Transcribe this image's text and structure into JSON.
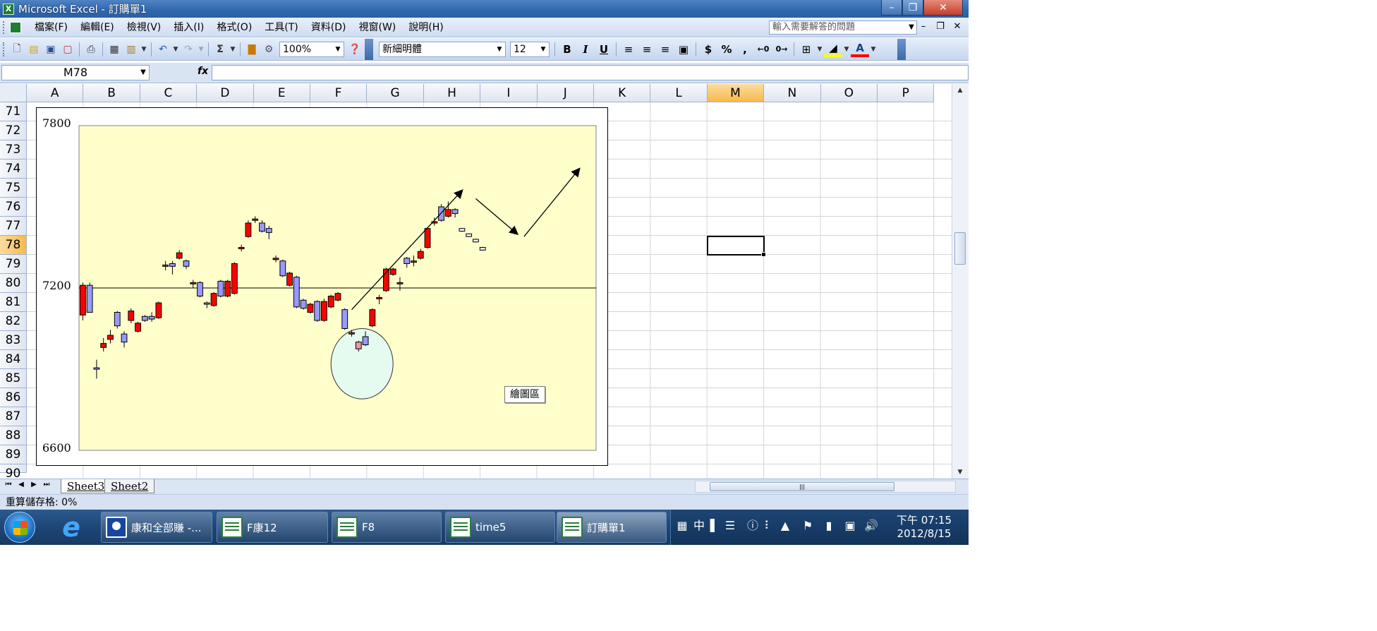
{
  "window": {
    "title": "Microsoft Excel - 訂購單1",
    "app_icon": "excel-icon"
  },
  "menu": {
    "items": [
      "檔案(F)",
      "編輯(E)",
      "檢視(V)",
      "插入(I)",
      "格式(O)",
      "工具(T)",
      "資料(D)",
      "視窗(W)",
      "說明(H)"
    ],
    "ask_placeholder": "輸入需要解答的問題"
  },
  "toolbar": {
    "zoom": "100%",
    "font_name": "新細明體",
    "font_size": "12",
    "bold": "B",
    "italic": "I",
    "underline": "U",
    "currency": "$",
    "percent": "%",
    "comma": ",",
    "sum": "Σ"
  },
  "formula": {
    "name_box": "M78",
    "fx_label": "fx",
    "value": ""
  },
  "grid": {
    "columns": [
      "A",
      "B",
      "C",
      "D",
      "E",
      "F",
      "G",
      "H",
      "I",
      "J",
      "K",
      "L",
      "M",
      "N",
      "O",
      "P"
    ],
    "rows": [
      "71",
      "72",
      "73",
      "74",
      "75",
      "76",
      "77",
      "78",
      "79",
      "80",
      "81",
      "82",
      "83",
      "84",
      "85",
      "86",
      "87",
      "88",
      "89",
      "90"
    ],
    "selected_column": "M",
    "selected_row": "78"
  },
  "sheets": {
    "tabs": [
      "Sheet3",
      "Sheet2"
    ]
  },
  "status": {
    "text": "重算儲存格: 0%"
  },
  "taskbar": {
    "items": [
      "康和全部賺 -...",
      "F康12",
      "F8",
      "time5",
      "訂購單1"
    ],
    "clock_time": "下午 07:15",
    "clock_date": "2012/8/15",
    "ime_label": "中"
  },
  "chart_data": {
    "type": "candlestick",
    "y_tick_labels": [
      "7800",
      "7200",
      "6600"
    ],
    "ylim": [
      6600,
      7800
    ],
    "reference_line": 7200,
    "plot_area_color": "#ffffcc",
    "up_color": "#ff0000",
    "down_color": "#9999ff",
    "plot_tooltip": "繪圖區",
    "candles": [
      {
        "o": 7100,
        "c": 7210,
        "h": 7220,
        "l": 7080,
        "up": true
      },
      {
        "o": 7210,
        "c": 7110,
        "h": 7220,
        "l": 7110,
        "up": false
      },
      {
        "o": 6900,
        "c": 6905,
        "h": 6935,
        "l": 6865,
        "up": false
      },
      {
        "o": 6980,
        "c": 6995,
        "h": 7015,
        "l": 6965,
        "up": true
      },
      {
        "o": 7010,
        "c": 7025,
        "h": 7045,
        "l": 6995,
        "up": true
      },
      {
        "o": 7110,
        "c": 7060,
        "h": 7115,
        "l": 7050,
        "up": false
      },
      {
        "o": 7030,
        "c": 7000,
        "h": 7040,
        "l": 6980,
        "up": false
      },
      {
        "o": 7080,
        "c": 7115,
        "h": 7125,
        "l": 7070,
        "up": true
      },
      {
        "o": 7040,
        "c": 7070,
        "h": 7075,
        "l": 7035,
        "up": true
      },
      {
        "o": 7095,
        "c": 7080,
        "h": 7100,
        "l": 7075,
        "up": false
      },
      {
        "o": 7095,
        "c": 7085,
        "h": 7110,
        "l": 7075,
        "up": false
      },
      {
        "o": 7090,
        "c": 7145,
        "h": 7150,
        "l": 7085,
        "up": true
      },
      {
        "o": 7280,
        "c": 7285,
        "h": 7300,
        "l": 7265,
        "up": true
      },
      {
        "o": 7280,
        "c": 7290,
        "h": 7300,
        "l": 7250,
        "up": false
      },
      {
        "o": 7330,
        "c": 7310,
        "h": 7340,
        "l": 7305,
        "up": true
      },
      {
        "o": 7300,
        "c": 7280,
        "h": 7305,
        "l": 7270,
        "up": false
      },
      {
        "o": 7215,
        "c": 7220,
        "h": 7230,
        "l": 7200,
        "up": true
      },
      {
        "o": 7220,
        "c": 7170,
        "h": 7225,
        "l": 7165,
        "up": false
      },
      {
        "o": 7145,
        "c": 7140,
        "h": 7150,
        "l": 7125,
        "up": false
      },
      {
        "o": 7135,
        "c": 7180,
        "h": 7185,
        "l": 7130,
        "up": true
      },
      {
        "o": 7225,
        "c": 7170,
        "h": 7230,
        "l": 7165,
        "up": false
      },
      {
        "o": 7170,
        "c": 7225,
        "h": 7230,
        "l": 7165,
        "up": true
      },
      {
        "o": 7180,
        "c": 7290,
        "h": 7295,
        "l": 7175,
        "up": true
      },
      {
        "o": 7345,
        "c": 7350,
        "h": 7360,
        "l": 7335,
        "up": true
      },
      {
        "o": 7390,
        "c": 7440,
        "h": 7450,
        "l": 7385,
        "up": true
      },
      {
        "o": 7450,
        "c": 7455,
        "h": 7465,
        "l": 7440,
        "up": true
      },
      {
        "o": 7440,
        "c": 7410,
        "h": 7450,
        "l": 7405,
        "up": false
      },
      {
        "o": 7420,
        "c": 7405,
        "h": 7430,
        "l": 7380,
        "up": false
      },
      {
        "o": 7305,
        "c": 7310,
        "h": 7320,
        "l": 7295,
        "up": true
      },
      {
        "o": 7300,
        "c": 7245,
        "h": 7305,
        "l": 7240,
        "up": false
      },
      {
        "o": 7210,
        "c": 7255,
        "h": 7260,
        "l": 7205,
        "up": true
      },
      {
        "o": 7240,
        "c": 7130,
        "h": 7245,
        "l": 7125,
        "up": false
      },
      {
        "o": 7155,
        "c": 7125,
        "h": 7160,
        "l": 7120,
        "up": false
      },
      {
        "o": 7110,
        "c": 7140,
        "h": 7145,
        "l": 7105,
        "up": true
      },
      {
        "o": 7150,
        "c": 7080,
        "h": 7155,
        "l": 7075,
        "up": false
      },
      {
        "o": 7080,
        "c": 7150,
        "h": 7160,
        "l": 7075,
        "up": true
      },
      {
        "o": 7130,
        "c": 7170,
        "h": 7175,
        "l": 7125,
        "up": true
      },
      {
        "o": 7155,
        "c": 7180,
        "h": 7185,
        "l": 7150,
        "up": true
      },
      {
        "o": 7120,
        "c": 7050,
        "h": 7125,
        "l": 7045,
        "up": false
      },
      {
        "o": 7030,
        "c": 7035,
        "h": 7045,
        "l": 7020,
        "up": true
      },
      {
        "o": 7000,
        "c": 6975,
        "h": 7005,
        "l": 6965,
        "up": true,
        "ghost": true
      },
      {
        "o": 7020,
        "c": 6990,
        "h": 7040,
        "l": 6985,
        "up": false
      },
      {
        "o": 7060,
        "c": 7120,
        "h": 7125,
        "l": 7055,
        "up": true
      },
      {
        "o": 7160,
        "c": 7165,
        "h": 7175,
        "l": 7140,
        "up": true
      },
      {
        "o": 7190,
        "c": 7270,
        "h": 7275,
        "l": 7185,
        "up": true
      },
      {
        "o": 7250,
        "c": 7270,
        "h": 7275,
        "l": 7245,
        "up": true
      },
      {
        "o": 7215,
        "c": 7220,
        "h": 7240,
        "l": 7190,
        "up": true
      },
      {
        "o": 7290,
        "c": 7310,
        "h": 7315,
        "l": 7275,
        "up": false
      },
      {
        "o": 7295,
        "c": 7300,
        "h": 7320,
        "l": 7280,
        "up": true
      },
      {
        "o": 7310,
        "c": 7335,
        "h": 7345,
        "l": 7305,
        "up": true
      },
      {
        "o": 7350,
        "c": 7420,
        "h": 7425,
        "l": 7345,
        "up": true
      },
      {
        "o": 7440,
        "c": 7445,
        "h": 7460,
        "l": 7430,
        "up": true
      },
      {
        "o": 7450,
        "c": 7500,
        "h": 7510,
        "l": 7445,
        "up": false
      },
      {
        "o": 7490,
        "c": 7465,
        "h": 7520,
        "l": 7460,
        "up": true
      },
      {
        "o": 7475,
        "c": 7490,
        "h": 7495,
        "l": 7460,
        "up": false
      },
      {
        "o": 7420,
        "c": 7410,
        "h": 7422,
        "l": 7408,
        "up": false,
        "faded": true
      },
      {
        "o": 7400,
        "c": 7390,
        "h": 7402,
        "l": 7388,
        "up": false,
        "faded": true
      },
      {
        "o": 7380,
        "c": 7370,
        "h": 7382,
        "l": 7368,
        "up": false,
        "faded": true
      },
      {
        "o": 7350,
        "c": 7340,
        "h": 7352,
        "l": 7338,
        "up": false,
        "faded": true
      }
    ],
    "arrows": [
      {
        "from": [
          39,
          7120
        ],
        "to": [
          55,
          7560
        ]
      },
      {
        "from": [
          57,
          7530
        ],
        "to": [
          63,
          7400
        ]
      },
      {
        "from": [
          64,
          7390
        ],
        "to": [
          72,
          7640
        ]
      }
    ],
    "circle_annotation": {
      "cx": 40.5,
      "cy": 6920,
      "rx": 4.5,
      "ry": 130,
      "fill": "#e6fbef"
    }
  }
}
